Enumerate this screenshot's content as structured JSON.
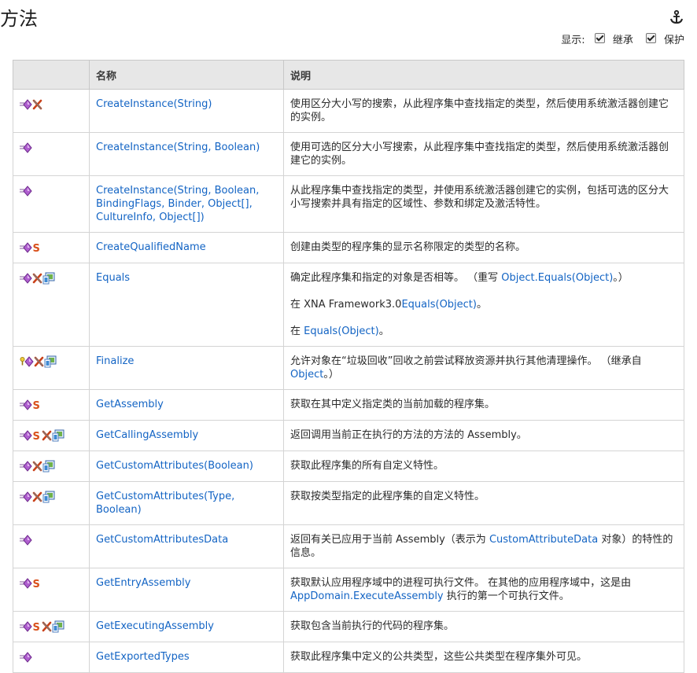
{
  "page": {
    "title": "方法",
    "filter_label": "显示:",
    "filters": [
      {
        "label": "继承",
        "checked": true
      },
      {
        "label": "保护",
        "checked": true
      }
    ]
  },
  "table": {
    "headers": [
      "",
      "名称",
      "说明"
    ],
    "rows": [
      {
        "icons": [
          "public-method-icon",
          "xna-framework-icon"
        ],
        "name": "CreateInstance(String)",
        "desc": [
          {
            "parts": [
              {
                "t": "使用区分大小写的搜索，从此程序集中查找指定的类型，然后使用系统激活器创建它的实例。"
              }
            ]
          }
        ]
      },
      {
        "icons": [
          "public-method-icon"
        ],
        "name": "CreateInstance(String, Boolean)",
        "desc": [
          {
            "parts": [
              {
                "t": "使用可选的区分大小写搜索，从此程序集中查找指定的类型，然后使用系统激活器创建它的实例。"
              }
            ]
          }
        ]
      },
      {
        "icons": [
          "public-method-icon"
        ],
        "name": "CreateInstance(String, Boolean, BindingFlags, Binder, Object[], CultureInfo, Object[])",
        "desc": [
          {
            "parts": [
              {
                "t": "从此程序集中查找指定的类型，并使用系统激活器创建它的实例，包括可选的区分大小写搜索并具有指定的区域性、参数和绑定及激活特性。"
              }
            ]
          }
        ]
      },
      {
        "icons": [
          "public-method-icon",
          "static-icon"
        ],
        "name": "CreateQualifiedName",
        "desc": [
          {
            "parts": [
              {
                "t": "创建由类型的程序集的显示名称限定的类型的名称。"
              }
            ]
          }
        ]
      },
      {
        "icons": [
          "public-method-icon",
          "xna-framework-icon",
          "portable-library-icon"
        ],
        "name": "Equals",
        "desc": [
          {
            "parts": [
              {
                "t": "确定此程序集和指定的对象是否相等。 （重写 "
              },
              {
                "t": "Object.Equals(Object)",
                "link": true
              },
              {
                "t": "。）"
              }
            ]
          },
          {
            "parts": [
              {
                "t": "在 XNA Framework3.0"
              },
              {
                "t": "Equals(Object)",
                "link": true
              },
              {
                "t": "。"
              }
            ]
          },
          {
            "parts": [
              {
                "t": "在 "
              },
              {
                "t": "Equals(Object)",
                "link": true
              },
              {
                "t": "。"
              }
            ]
          }
        ]
      },
      {
        "icons": [
          "protected-method-icon",
          "xna-framework-icon",
          "portable-library-icon"
        ],
        "name": "Finalize",
        "desc": [
          {
            "parts": [
              {
                "t": "允许对象在“垃圾回收”回收之前尝试释放资源并执行其他清理操作。 （继承自 "
              },
              {
                "t": "Object",
                "link": true
              },
              {
                "t": "。）"
              }
            ]
          }
        ]
      },
      {
        "icons": [
          "public-method-icon",
          "static-icon"
        ],
        "name": "GetAssembly",
        "desc": [
          {
            "parts": [
              {
                "t": "获取在其中定义指定类的当前加载的程序集。"
              }
            ]
          }
        ]
      },
      {
        "icons": [
          "public-method-icon",
          "static-icon",
          "xna-framework-icon",
          "portable-library-icon"
        ],
        "name": "GetCallingAssembly",
        "desc": [
          {
            "parts": [
              {
                "t": "返回调用当前正在执行的方法的方法的 Assembly。"
              }
            ]
          }
        ]
      },
      {
        "icons": [
          "public-method-icon",
          "xna-framework-icon",
          "portable-library-icon"
        ],
        "name": "GetCustomAttributes(Boolean)",
        "desc": [
          {
            "parts": [
              {
                "t": "获取此程序集的所有自定义特性。"
              }
            ]
          }
        ]
      },
      {
        "icons": [
          "public-method-icon",
          "xna-framework-icon",
          "portable-library-icon"
        ],
        "name": "GetCustomAttributes(Type, Boolean)",
        "desc": [
          {
            "parts": [
              {
                "t": "获取按类型指定的此程序集的自定义特性。"
              }
            ]
          }
        ]
      },
      {
        "icons": [
          "public-method-icon"
        ],
        "name": "GetCustomAttributesData",
        "desc": [
          {
            "parts": [
              {
                "t": "返回有关已应用于当前 Assembly（表示为 "
              },
              {
                "t": "CustomAttributeData",
                "link": true
              },
              {
                "t": " 对象）的特性的信息。"
              }
            ]
          }
        ]
      },
      {
        "icons": [
          "public-method-icon",
          "static-icon"
        ],
        "name": "GetEntryAssembly",
        "desc": [
          {
            "parts": [
              {
                "t": "获取默认应用程序域中的进程可执行文件。 在其他的应用程序域中，这是由 "
              },
              {
                "t": "AppDomain.ExecuteAssembly",
                "link": true
              },
              {
                "t": " 执行的第一个可执行文件。"
              }
            ]
          }
        ]
      },
      {
        "icons": [
          "public-method-icon",
          "static-icon",
          "xna-framework-icon",
          "portable-library-icon"
        ],
        "name": "GetExecutingAssembly",
        "desc": [
          {
            "parts": [
              {
                "t": "获取包含当前执行的代码的程序集。"
              }
            ]
          }
        ]
      },
      {
        "icons": [
          "public-method-icon"
        ],
        "name": "GetExportedTypes",
        "desc": [
          {
            "parts": [
              {
                "t": "获取此程序集中定义的公共类型，这些公共类型在程序集外可见。"
              }
            ]
          }
        ]
      }
    ]
  }
}
